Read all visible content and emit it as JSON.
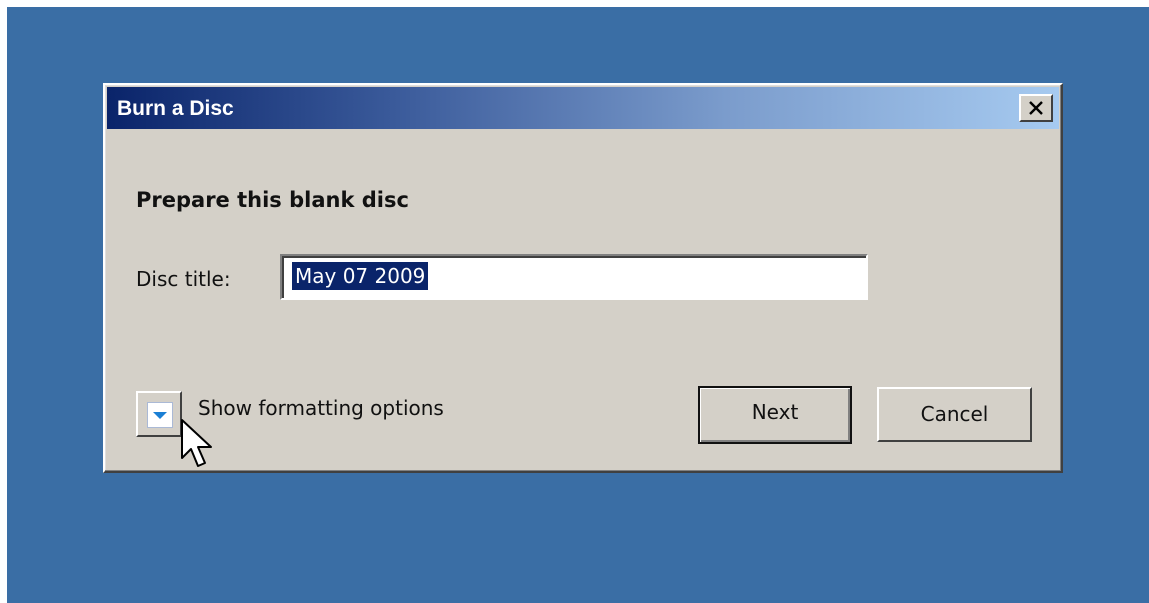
{
  "desktop": {
    "background_color": "#3a6ea5"
  },
  "dialog": {
    "title": "Burn a Disc",
    "close_icon": "close-x-icon",
    "heading": "Prepare this blank disc",
    "disc_title_label": "Disc title:",
    "disc_title_value": "May 07 2009",
    "disc_title_selected": true,
    "expand_icon": "chevron-down-icon",
    "show_formatting_options_label": "Show formatting options",
    "next_label": "Next",
    "cancel_label": "Cancel"
  },
  "colors": {
    "titlebar_start": "#0a246a",
    "titlebar_end": "#a6caf0",
    "dialog_face": "#d4d0c8",
    "selection": "#0a246a",
    "chevron_accent": "#1a7fd4"
  },
  "cursor": {
    "icon": "arrow-pointer-icon"
  }
}
